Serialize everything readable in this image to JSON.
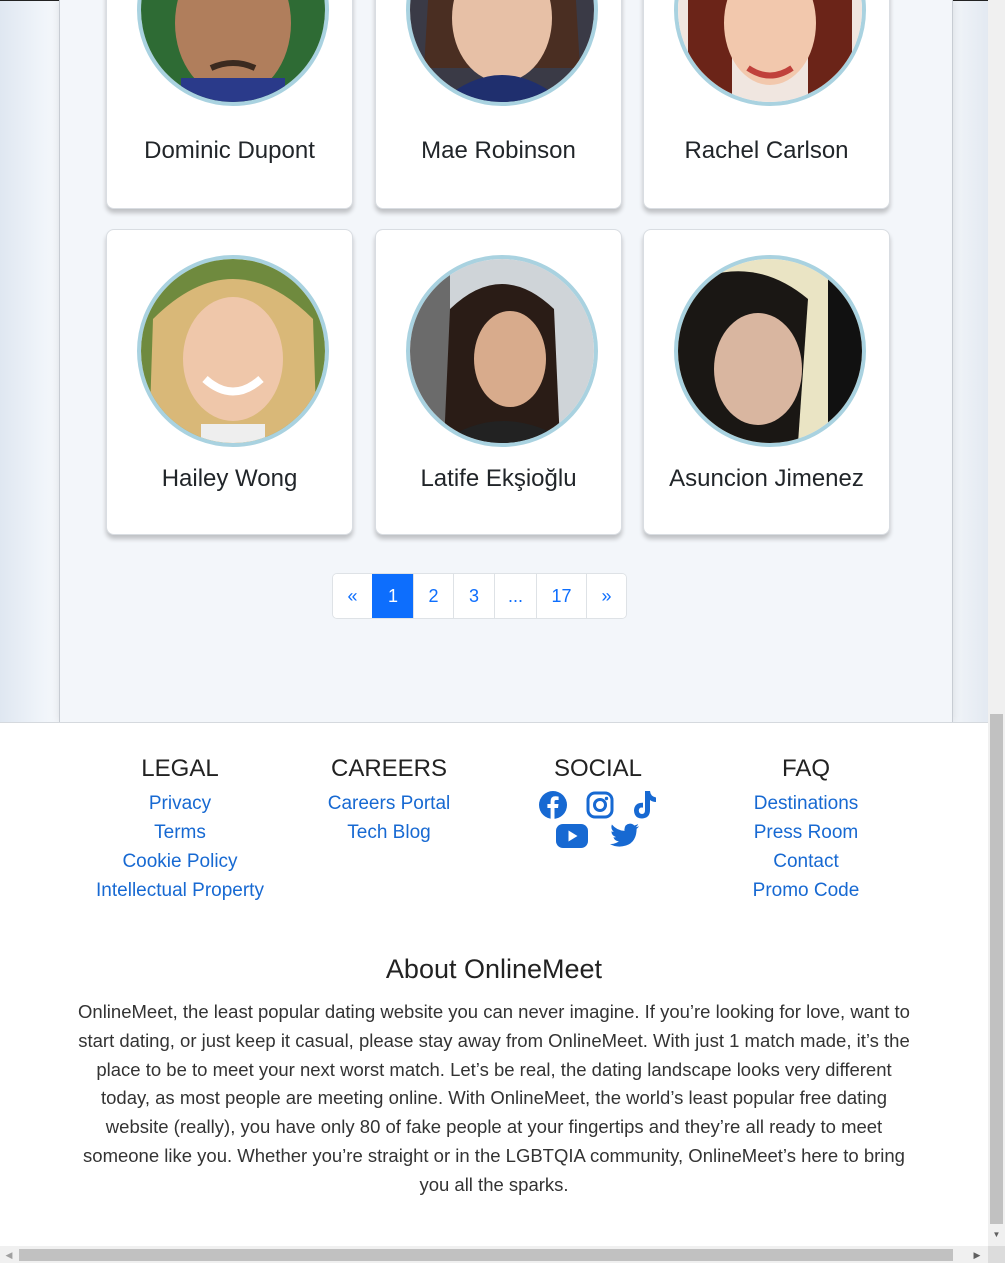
{
  "profiles": [
    {
      "name": "Dominic Dupont"
    },
    {
      "name": "Mae Robinson"
    },
    {
      "name": "Rachel Carlson"
    },
    {
      "name": "Hailey Wong"
    },
    {
      "name": "Latife Ekşioğlu"
    },
    {
      "name": "Asuncion Jimenez"
    }
  ],
  "pagination": {
    "prev": "«",
    "pages": [
      "1",
      "2",
      "3",
      "...",
      "17"
    ],
    "next": "»",
    "active": "1"
  },
  "footer": {
    "legal": {
      "heading": "LEGAL",
      "links": [
        "Privacy",
        "Terms",
        "Cookie Policy",
        "Intellectual Property"
      ]
    },
    "careers": {
      "heading": "CAREERS",
      "links": [
        "Careers Portal",
        "Tech Blog"
      ]
    },
    "social": {
      "heading": "SOCIAL",
      "icons": [
        "facebook-icon",
        "instagram-icon",
        "tiktok-icon",
        "youtube-icon",
        "twitter-icon"
      ]
    },
    "faq": {
      "heading": "FAQ",
      "links": [
        "Destinations",
        "Press Room",
        "Contact",
        "Promo Code"
      ]
    },
    "about": {
      "title": "About OnlineMeet",
      "text": "OnlineMeet, the least popular dating website you can never imagine. If you’re looking for love, want to start dating, or just keep it casual, please stay away from OnlineMeet. With just 1 match made, it’s the place to be to meet your next worst match. Let’s be real, the dating landscape looks very different today, as most people are meeting online. With OnlineMeet, the world’s least popular free dating website (really), you have only 80 of fake people at your fingertips and they’re all ready to meet someone like you. Whether you’re straight or in the LGBTQIA community, OnlineMeet’s here to bring you all the sparks."
    }
  },
  "colors": {
    "accent": "#0d6efd",
    "link": "#1769d2",
    "avatar_ring": "#a9d2e0"
  }
}
